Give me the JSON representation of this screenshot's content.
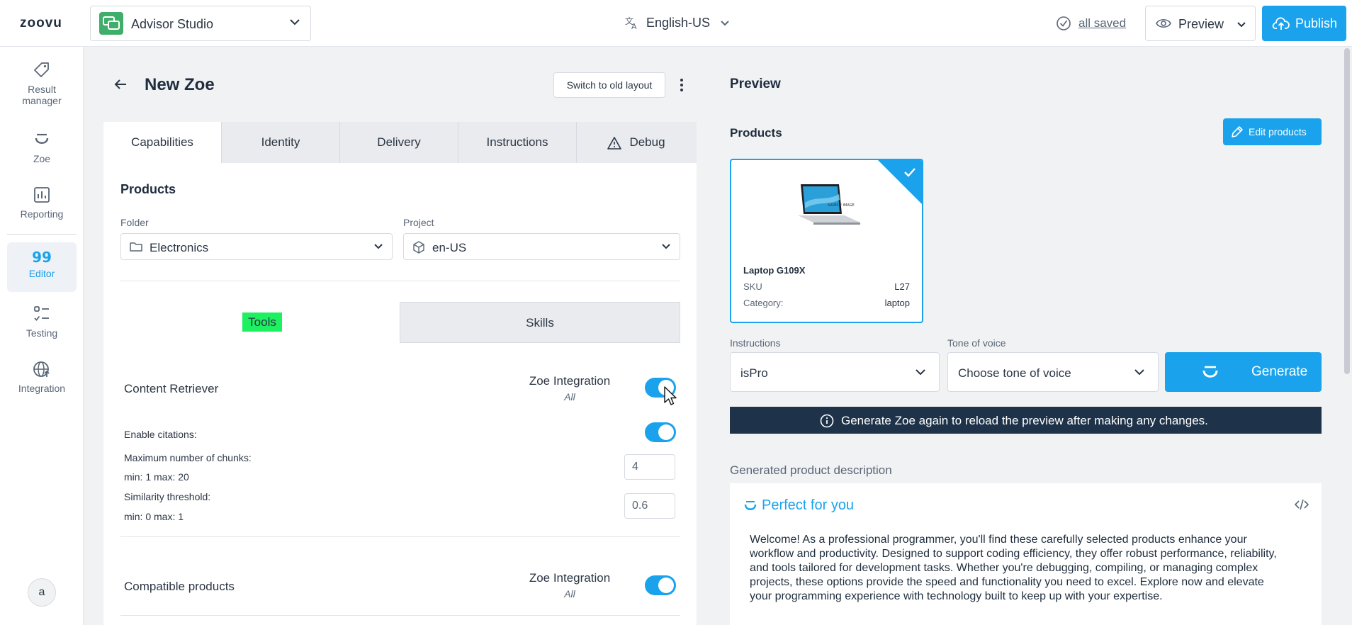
{
  "topbar": {
    "logo": "zoovu",
    "app_name": "Advisor Studio",
    "language": "English-US",
    "saved_status": "all saved",
    "preview_label": "Preview",
    "publish_label": "Publish"
  },
  "nav": {
    "items": [
      {
        "label_1": "Result",
        "label_2": "manager"
      },
      {
        "label_1": "Zoe"
      },
      {
        "label_1": "Reporting"
      },
      {
        "label_1": "Editor"
      },
      {
        "label_1": "Testing"
      },
      {
        "label_1": "Integration"
      }
    ],
    "active": "Editor",
    "avatar_letter": "a"
  },
  "editor": {
    "title": "New Zoe",
    "switch_layout_label": "Switch to old layout",
    "tabs": [
      "Capabilities",
      "Identity",
      "Delivery",
      "Instructions",
      "Debug"
    ],
    "active_tab": "Capabilities",
    "products_title": "Products",
    "folder_label": "Folder",
    "folder_value": "Electronics",
    "project_label": "Project",
    "project_value": "en-US",
    "subtabs": [
      "Tools",
      "Skills"
    ],
    "content_retriever": {
      "title": "Content Retriever",
      "integration_label": "Zoe Integration",
      "integration_sub": "All",
      "enabled": true,
      "enable_citations_label": "Enable citations:",
      "citations_enabled": true,
      "max_chunks_label": "Maximum number of chunks:",
      "max_chunks_range": "min: 1 max: 20",
      "max_chunks_value": "4",
      "similarity_label": "Similarity threshold:",
      "similarity_range": "min: 0 max: 1",
      "similarity_value": "0.6"
    },
    "compatible_products": {
      "title": "Compatible products",
      "integration_label": "Zoe Integration",
      "integration_sub": "All",
      "enabled": true
    }
  },
  "preview": {
    "title": "Preview",
    "products_title": "Products",
    "edit_products_label": "Edit products",
    "product": {
      "name": "Laptop G109X",
      "sku_key": "SKU",
      "sku_value": "L27",
      "category_key": "Category:",
      "category_value": "laptop",
      "image_caption": "SAMPLE IMAGE"
    },
    "instructions_label": "Instructions",
    "instructions_value": "isPro",
    "tone_label": "Tone of voice",
    "tone_placeholder": "Choose tone of voice",
    "generate_label": "Generate",
    "notice": "Generate Zoe again to reload the preview after making any changes.",
    "generated_label": "Generated product description",
    "generated_heading": "Perfect for you",
    "generated_text": "Welcome! As a professional programmer, you'll find these carefully selected products enhance your workflow and productivity. Designed to support coding efficiency, they offer robust performance, reliability, and tools tailored for development tasks. Whether you're debugging, compiling, or managing complex projects, these options provide the speed and functionality you need to excel. Explore now and elevate your programming experience with technology built to keep up with your expertise."
  },
  "colors": {
    "accent": "#1aa3ec",
    "notice_bg": "#1e3349",
    "highlight": "#1df061",
    "app_icon": "#3fae6a"
  }
}
